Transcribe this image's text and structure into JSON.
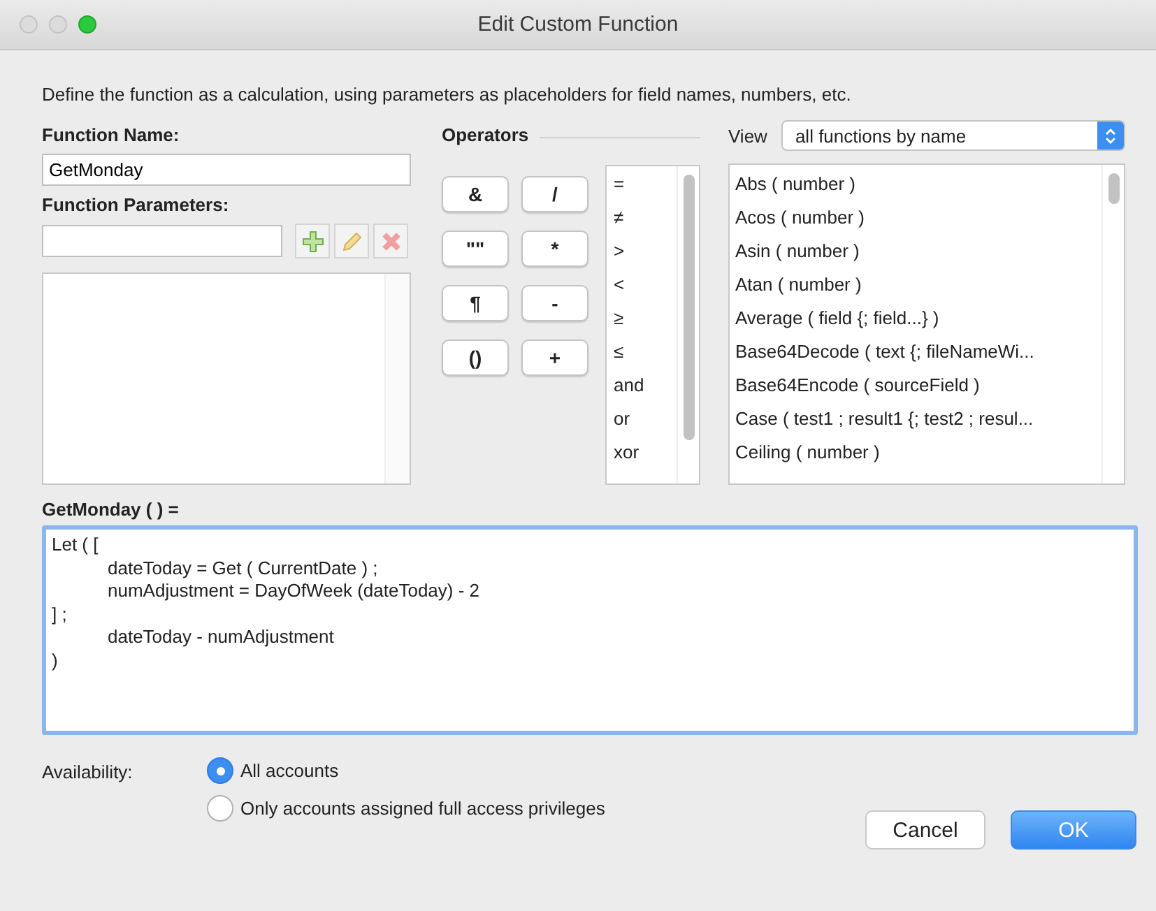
{
  "window": {
    "title": "Edit Custom Function"
  },
  "description": "Define the function as a calculation, using parameters as placeholders for field names, numbers, etc.",
  "function_name": {
    "label": "Function Name:",
    "value": "GetMonday"
  },
  "function_parameters": {
    "label": "Function Parameters:"
  },
  "operators": {
    "label": "Operators",
    "buttons": [
      "&",
      "/",
      "\"\"",
      "*",
      "¶",
      "-",
      "()",
      "+"
    ],
    "comparison_list": [
      "=",
      "≠",
      ">",
      "<",
      "≥",
      "≤",
      "and",
      "or",
      "xor"
    ]
  },
  "view": {
    "label": "View",
    "value": "all functions by name"
  },
  "functions": [
    "Abs ( number )",
    "Acos ( number )",
    "Asin ( number )",
    "Atan ( number )",
    "Average ( field {; field...} )",
    "Base64Decode ( text {; fileNameWi...",
    "Base64Encode ( sourceField )",
    "Case ( test1 ; result1 {; test2 ; resul...",
    "Ceiling ( number )"
  ],
  "formula": {
    "label": "GetMonday (  ) =",
    "lines": [
      {
        "kind": "plain",
        "text": "Let ( ["
      },
      {
        "kind": "indented",
        "text": "dateToday = Get ( CurrentDate ) ;"
      },
      {
        "kind": "indented",
        "text": "numAdjustment = DayOfWeek (dateToday) - 2"
      },
      {
        "kind": "plain",
        "text": "] ;"
      },
      {
        "kind": "indented",
        "text": "dateToday - numAdjustment"
      },
      {
        "kind": "plain",
        "text": ")"
      }
    ]
  },
  "availability": {
    "label": "Availability:",
    "options": [
      {
        "label": "All accounts",
        "selected": true
      },
      {
        "label": "Only accounts assigned full access privileges",
        "selected": false
      }
    ]
  },
  "buttons": [
    {
      "label": "Cancel",
      "kind": "secondary"
    },
    {
      "label": "OK",
      "kind": "primary"
    }
  ]
}
